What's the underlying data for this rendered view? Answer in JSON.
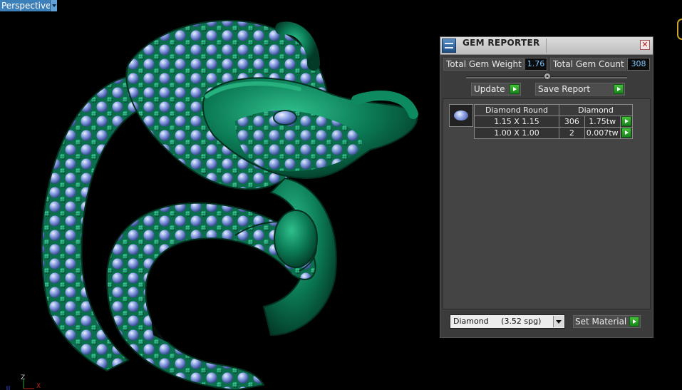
{
  "viewport": {
    "label": "Perspective",
    "axis_labels": {
      "z": "Z",
      "x": "X"
    }
  },
  "panel": {
    "title": "GEM REPORTER",
    "close_icon": "close-icon",
    "total_gem_weight_label": "Total Gem Weight",
    "total_gem_weight_value": "1.76",
    "total_gem_count_label": "Total Gem Count",
    "total_gem_count_value": "308",
    "update_label": "Update",
    "save_report_label": "Save Report",
    "gem_table": {
      "header": [
        "Diamond Round",
        "Diamond"
      ],
      "rows": [
        {
          "size": "1.15 X 1.15",
          "count": "306",
          "weight": "1.75tw"
        },
        {
          "size": "1.00 X 1.00",
          "count": "2",
          "weight": "0.007tw"
        }
      ]
    },
    "material_select_value": "Diamond     (3.52 spg)",
    "set_material_label": "Set Material"
  },
  "colors": {
    "metal": "#0b7a55",
    "gem": "#8fa5e6",
    "panel_bg": "#3b3b3b",
    "accent_go": "#2aa52a",
    "value_text": "#7ec8ff"
  }
}
